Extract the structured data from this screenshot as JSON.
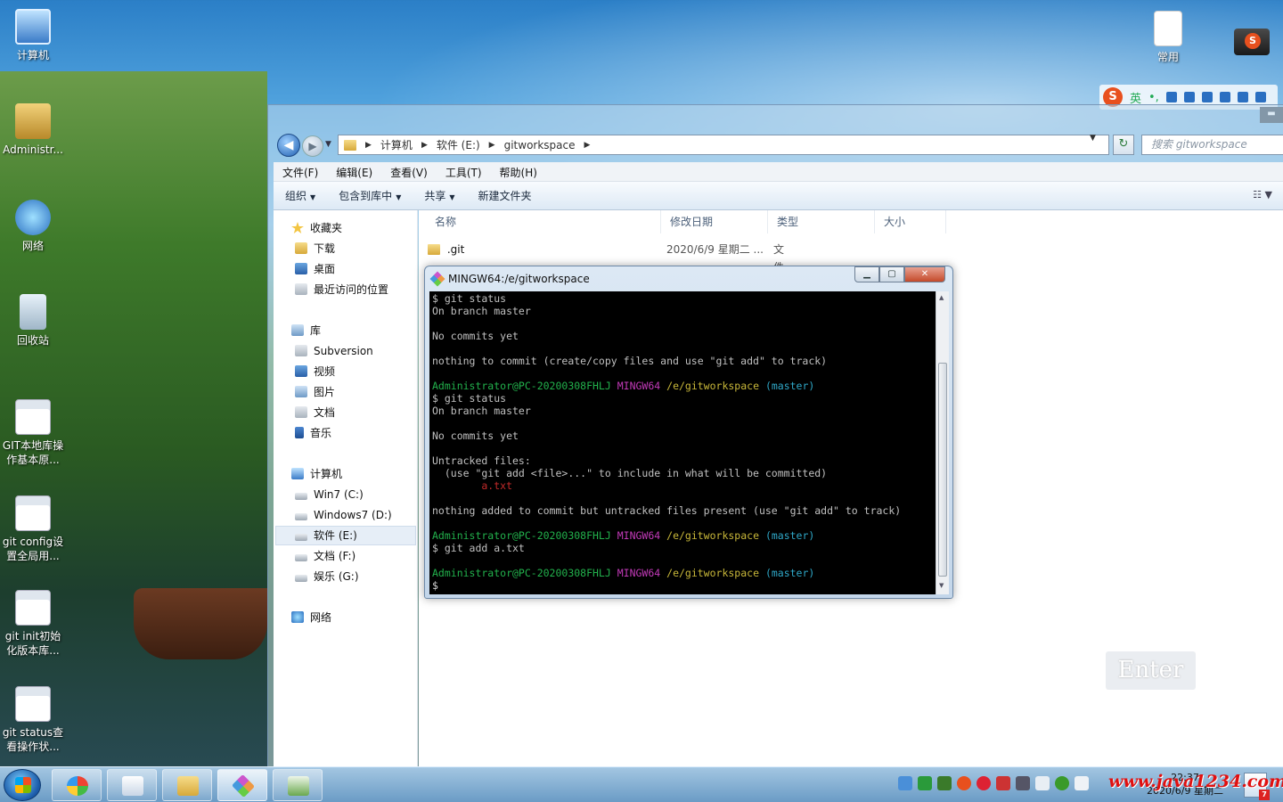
{
  "desktop": {
    "icons": [
      {
        "label": "计算机"
      },
      {
        "label": "Administr..."
      },
      {
        "label": "网络"
      },
      {
        "label": "回收站"
      },
      {
        "label": "GIT本地库操作基本原..."
      },
      {
        "label": "git config设置全局用..."
      },
      {
        "label": "git init初始化版本库..."
      },
      {
        "label": "git status查看操作状..."
      }
    ],
    "right_icon": {
      "label": "常用"
    }
  },
  "ime": {
    "lang": "英",
    "punct": "•,"
  },
  "explorer": {
    "breadcrumb": [
      "计算机",
      "软件 (E:)",
      "gitworkspace"
    ],
    "search_placeholder": "搜索 gitworkspace",
    "menu": [
      "文件(F)",
      "编辑(E)",
      "查看(V)",
      "工具(T)",
      "帮助(H)"
    ],
    "toolbar": [
      "组织",
      "包含到库中",
      "共享",
      "新建文件夹"
    ],
    "nav": {
      "favorites": {
        "title": "收藏夹",
        "items": [
          "下载",
          "桌面",
          "最近访问的位置"
        ]
      },
      "libraries": {
        "title": "库",
        "items": [
          "Subversion",
          "视频",
          "图片",
          "文档",
          "音乐"
        ]
      },
      "computer": {
        "title": "计算机",
        "items": [
          "Win7 (C:)",
          "Windows7 (D:)",
          "软件 (E:)",
          "文档 (F:)",
          "娱乐 (G:)"
        ]
      },
      "network": {
        "title": "网络"
      }
    },
    "columns": [
      "名称",
      "修改日期",
      "类型",
      "大小"
    ],
    "files": [
      {
        "name": ".git",
        "date": "2020/6/9 星期二 ...",
        "type": "文件夹"
      }
    ]
  },
  "terminal": {
    "title": "MINGW64:/e/gitworkspace",
    "prompt_user": "Administrator@PC-20200308FHLJ",
    "prompt_sys": "MINGW64",
    "prompt_path": "/e/gitworkspace",
    "prompt_branch": "(master)",
    "lines": {
      "l1": "$ git status",
      "l2": "On branch master",
      "l3": "No commits yet",
      "l4": "nothing to commit (create/copy files and use \"git add\" to track)",
      "l5": "$ git status",
      "l6": "On branch master",
      "l7": "No commits yet",
      "l8": "Untracked files:",
      "l9": "  (use \"git add <file>...\" to include in what will be committed)",
      "l10": "        a.txt",
      "l11": "nothing added to commit but untracked files present (use \"git add\" to track)",
      "l12": "$ git add a.txt",
      "l13": "$"
    }
  },
  "overlay": {
    "enter_key": "Enter"
  },
  "taskbar": {
    "clock_time": "22:37",
    "clock_date": "2020/6/9 星期二",
    "notif_count": "7",
    "watermark": "www.java1234.com"
  }
}
